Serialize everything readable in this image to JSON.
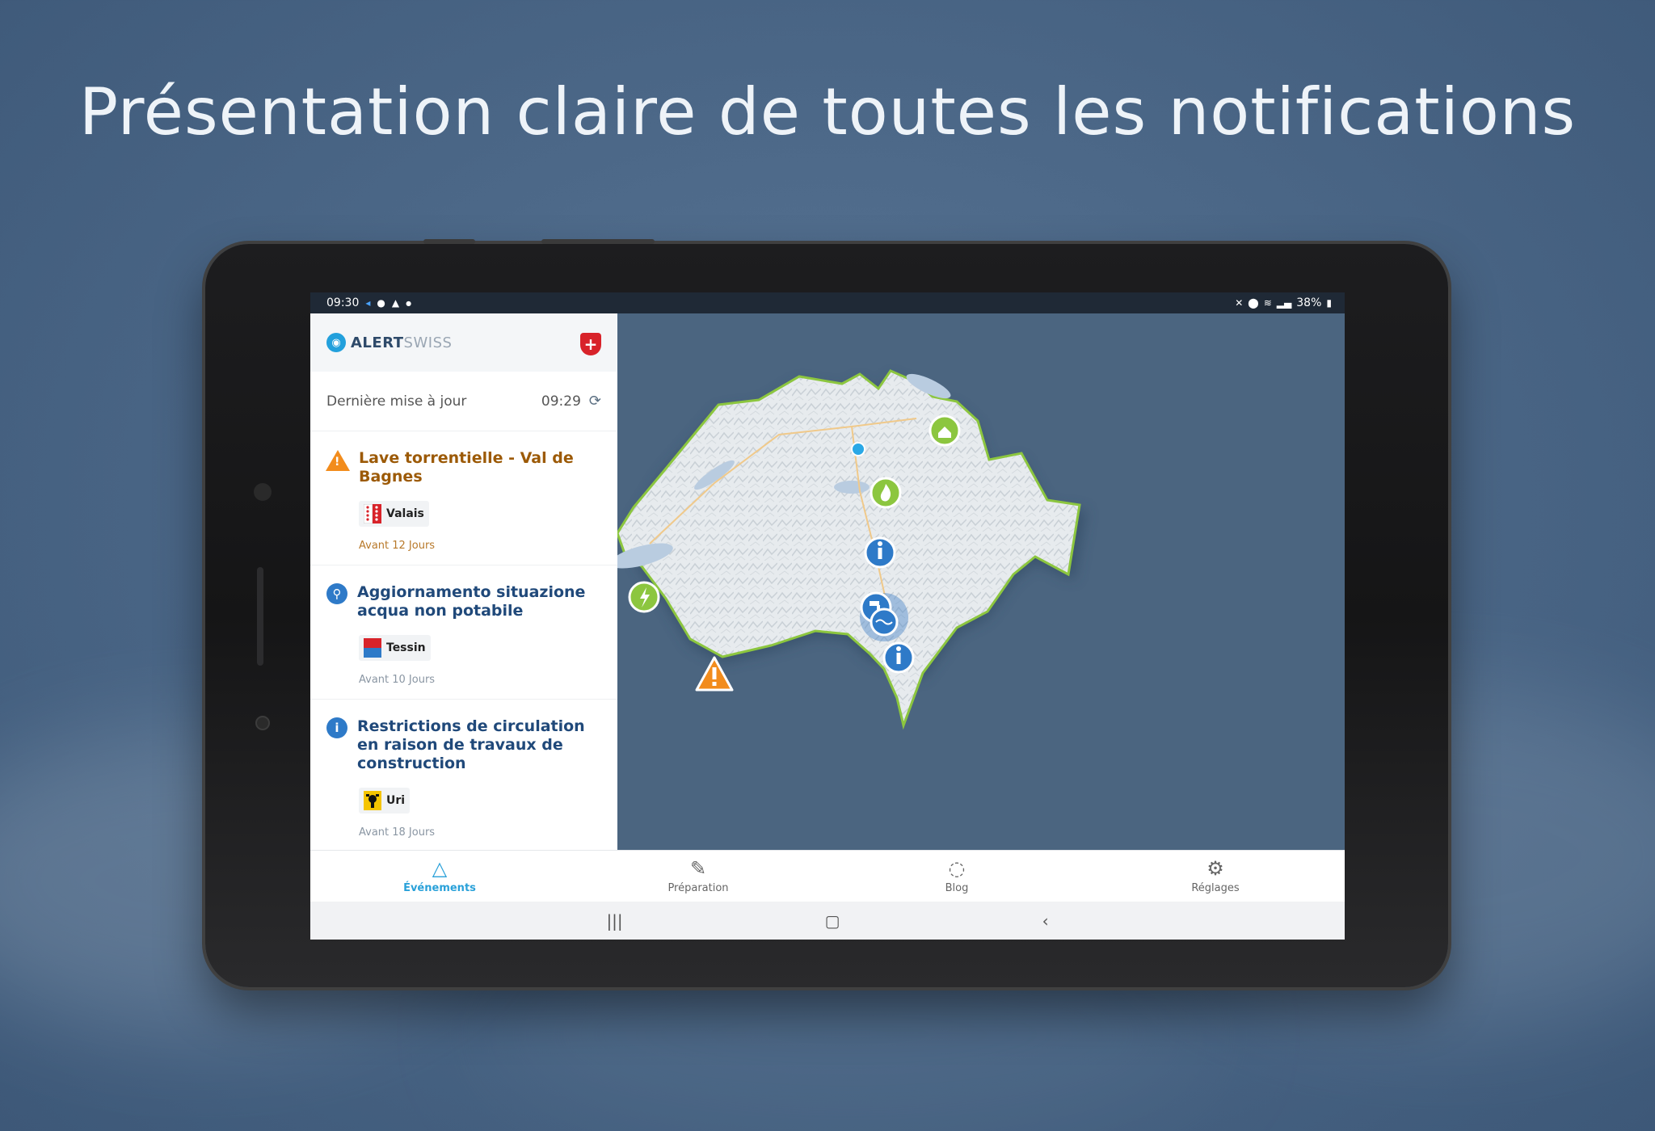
{
  "headline": "Présentation claire de toutes les notifications",
  "status_bar": {
    "time": "09:30",
    "battery": "38%"
  },
  "app": {
    "logo": {
      "bold": "ALERT",
      "light": "SWISS"
    },
    "last_update_label": "Dernière mise à jour",
    "last_update_time": "09:29"
  },
  "events": [
    {
      "title": "Lave torrentielle - Val de Bagnes",
      "region": "Valais",
      "time": "Avant 12 Jours",
      "icon": "warning-icon",
      "color": "#f28c1c"
    },
    {
      "title": "Aggiornamento situazione acqua non potabile",
      "region": "Tessin",
      "time": "Avant 10 Jours",
      "icon": "water-tap-icon",
      "color": "#2e7ac8"
    },
    {
      "title": "Restrictions de circulation en raison de travaux de construction",
      "region": "Uri",
      "time": "Avant 18 Jours",
      "icon": "info-icon",
      "color": "#2e7ac8"
    }
  ],
  "nav": [
    {
      "label": "Événements",
      "icon": "warning-outline-icon",
      "active": true
    },
    {
      "label": "Préparation",
      "icon": "edit-icon",
      "active": false
    },
    {
      "label": "Blog",
      "icon": "chat-icon",
      "active": false
    },
    {
      "label": "Réglages",
      "icon": "gear-icon",
      "active": false
    }
  ],
  "map_markers": [
    {
      "type": "flood-house-icon",
      "color": "#8cc63f"
    },
    {
      "type": "location-dot",
      "color": "#2aa8e6"
    },
    {
      "type": "fire-icon",
      "color": "#8cc63f"
    },
    {
      "type": "info-icon",
      "color": "#2e7ac8"
    },
    {
      "type": "power-icon",
      "color": "#8cc63f"
    },
    {
      "type": "water-tap-icon",
      "color": "#2e7ac8"
    },
    {
      "type": "info-icon",
      "color": "#2e7ac8"
    },
    {
      "type": "warning-icon",
      "color": "#f28c1c"
    }
  ]
}
